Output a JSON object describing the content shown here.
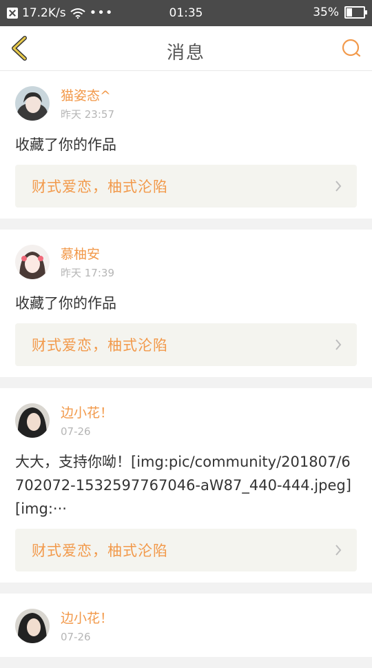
{
  "status_bar": {
    "speed": "17.2K/s",
    "time": "01:35",
    "battery": "35%",
    "battery_level": 0.35
  },
  "header": {
    "title": "消息"
  },
  "colors": {
    "accent": "#f2994a",
    "back_icon": "#e6c84a"
  },
  "messages": [
    {
      "username": "猫姿态^",
      "time": "昨天 23:57",
      "content": "收藏了你的作品",
      "work_title": "财式爱恋，柚式沦陷"
    },
    {
      "username": "慕柚安",
      "time": "昨天 17:39",
      "content": "收藏了你的作品",
      "work_title": "财式爱恋，柚式沦陷"
    },
    {
      "username": "边小花！",
      "time": "07-26",
      "content": "大大，支持你呦！[img:pic/community/201807/6702072-1532597767046-aW87_440-444.jpeg] [img:···",
      "work_title": "财式爱恋，柚式沦陷"
    },
    {
      "username": "边小花！",
      "time": "07-26"
    }
  ]
}
